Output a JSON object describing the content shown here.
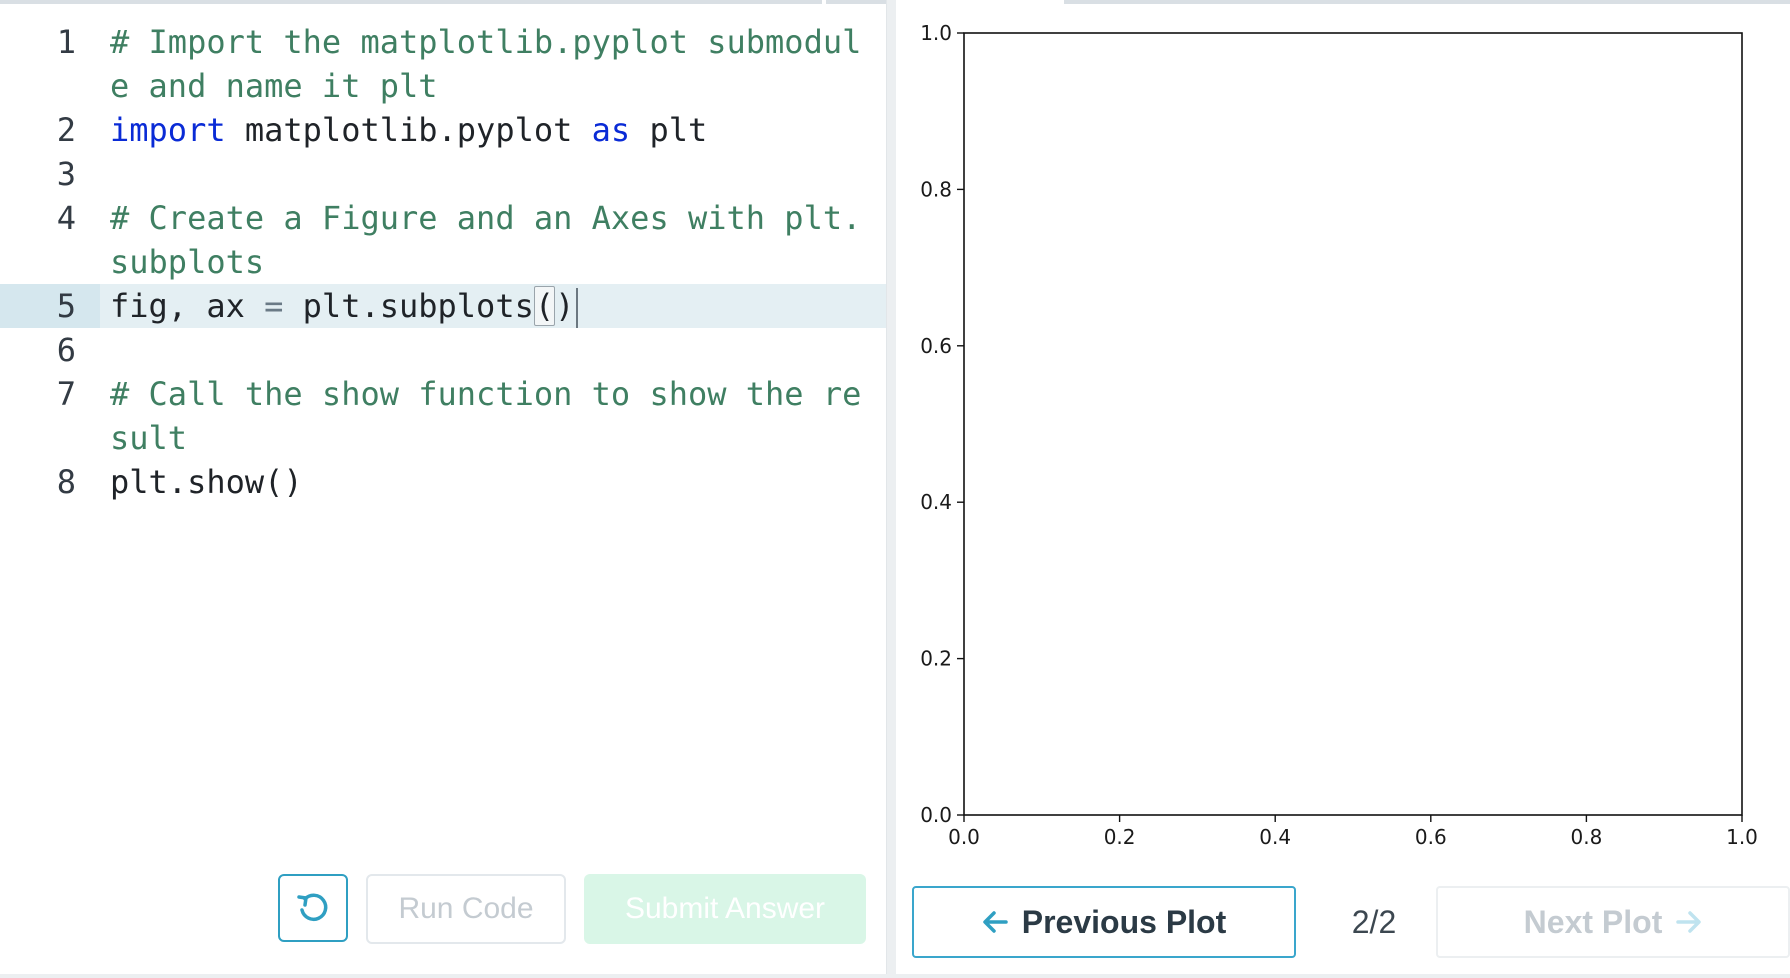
{
  "editor": {
    "lines": [
      {
        "no": "1",
        "parts": [
          {
            "cls": "c-comment",
            "text": "# Import the matplotlib.pyplot submodule and name it plt"
          }
        ]
      },
      {
        "no": "2",
        "parts": [
          {
            "cls": "c-kw",
            "text": "import"
          },
          {
            "cls": "",
            "text": " matplotlib.pyplot "
          },
          {
            "cls": "c-kw",
            "text": "as"
          },
          {
            "cls": "",
            "text": " plt"
          }
        ]
      },
      {
        "no": "3",
        "parts": []
      },
      {
        "no": "4",
        "parts": [
          {
            "cls": "c-comment",
            "text": "# Create a Figure and an Axes with plt.subplots"
          }
        ]
      },
      {
        "no": "5",
        "active": true,
        "parts": [
          {
            "cls": "",
            "text": "fig, ax "
          },
          {
            "cls": "c-op",
            "text": "="
          },
          {
            "cls": "",
            "text": " plt.subplots"
          },
          {
            "cls": "bracket-box",
            "text": "("
          },
          {
            "cls": "",
            "text": ")"
          }
        ]
      },
      {
        "no": "6",
        "parts": []
      },
      {
        "no": "7",
        "parts": [
          {
            "cls": "c-comment",
            "text": "# Call the show function to show the result"
          }
        ]
      },
      {
        "no": "8",
        "parts": [
          {
            "cls": "",
            "text": "plt.show()"
          }
        ]
      }
    ],
    "buttons": {
      "run_label": "Run Code",
      "submit_label": "Submit Answer",
      "reset_icon": "reset-icon"
    }
  },
  "plot_nav": {
    "prev_label": "Previous Plot",
    "next_label": "Next Plot",
    "counter": "2/2"
  },
  "chart_data": {
    "type": "scatter",
    "series": [],
    "xlim": [
      0.0,
      1.0
    ],
    "ylim": [
      0.0,
      1.0
    ],
    "x_ticks": [
      "0.0",
      "0.2",
      "0.4",
      "0.6",
      "0.8",
      "1.0"
    ],
    "y_ticks": [
      "0.0",
      "0.2",
      "0.4",
      "0.6",
      "0.8",
      "1.0"
    ],
    "title": "",
    "xlabel": "",
    "ylabel": "",
    "grid": false
  },
  "colors": {
    "accent": "#2f9fc2",
    "comment": "#3f7f62",
    "keyword": "#0a2bd6",
    "submit_bg": "#d9f6e7"
  }
}
